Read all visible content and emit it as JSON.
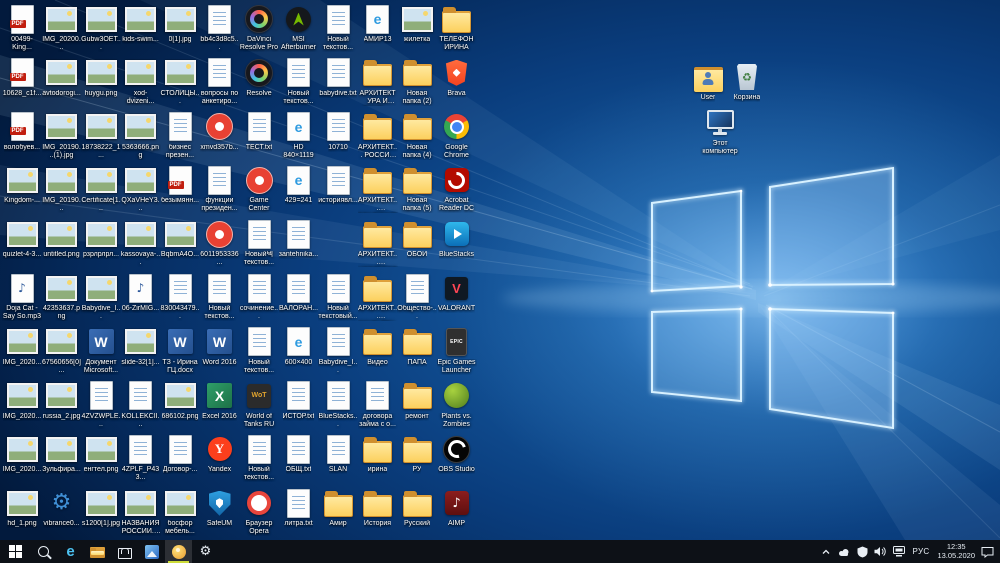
{
  "desktop": {
    "icons": [
      {
        "col": 1,
        "row": 1,
        "label": "00499-King...",
        "type": "pdf"
      },
      {
        "col": 2,
        "row": 1,
        "label": "IMG_20200...",
        "type": "image"
      },
      {
        "col": 3,
        "row": 1,
        "label": "Gubw3OET...",
        "type": "image"
      },
      {
        "col": 4,
        "row": 1,
        "label": "kids-swim...",
        "type": "image"
      },
      {
        "col": 5,
        "row": 1,
        "label": "0[1].jpg",
        "type": "image"
      },
      {
        "col": 6,
        "row": 1,
        "label": "bb4c3d8c5...",
        "type": "text"
      },
      {
        "col": 7,
        "row": 1,
        "label": "DaVinci Resolve Pro",
        "type": "davinci"
      },
      {
        "col": 8,
        "row": 1,
        "label": "MSI Afterburner",
        "type": "msi"
      },
      {
        "col": 9,
        "row": 1,
        "label": "Новый текстов...",
        "type": "text"
      },
      {
        "col": 10,
        "row": 1,
        "label": "АМИР13",
        "type": "html"
      },
      {
        "col": 11,
        "row": 1,
        "label": "жилетка",
        "type": "image"
      },
      {
        "col": 12,
        "row": 1,
        "label": "ТЕЛЕФОН ИРИНА",
        "type": "folder"
      },
      {
        "col": 1,
        "row": 2,
        "label": "10628_c1f...",
        "type": "pdf"
      },
      {
        "col": 2,
        "row": 2,
        "label": "avtodorogi...",
        "type": "image"
      },
      {
        "col": 3,
        "row": 2,
        "label": "huygu.png",
        "type": "image"
      },
      {
        "col": 4,
        "row": 2,
        "label": "xod-dvizeni...",
        "type": "image"
      },
      {
        "col": 5,
        "row": 2,
        "label": "СТОЛИЦЫ...",
        "type": "image"
      },
      {
        "col": 6,
        "row": 2,
        "label": "вопросы по анкетиро...",
        "type": "text"
      },
      {
        "col": 7,
        "row": 2,
        "label": "Resolve",
        "type": "davinci"
      },
      {
        "col": 8,
        "row": 2,
        "label": "Новый текстов...",
        "type": "text"
      },
      {
        "col": 9,
        "row": 2,
        "label": "babydive.txt",
        "type": "text"
      },
      {
        "col": 10,
        "row": 2,
        "label": "АРХИТЕКТУРА И СКУЛЬ...",
        "type": "folder"
      },
      {
        "col": 11,
        "row": 2,
        "label": "Новая папка (2)",
        "type": "folder"
      },
      {
        "col": 12,
        "row": 2,
        "label": "Brava",
        "type": "brave"
      },
      {
        "col": 1,
        "row": 3,
        "label": "волобуев...",
        "type": "pdf"
      },
      {
        "col": 2,
        "row": 3,
        "label": "IMG_20190...(1).jpg",
        "type": "image"
      },
      {
        "col": 3,
        "row": 3,
        "label": "18738222_1...",
        "type": "image"
      },
      {
        "col": 4,
        "row": 3,
        "label": "5363666.png",
        "type": "image"
      },
      {
        "col": 5,
        "row": 3,
        "label": "бизнес презен...",
        "type": "text"
      },
      {
        "col": 6,
        "row": 3,
        "label": "xmvd357b...",
        "type": "gamecenter"
      },
      {
        "col": 7,
        "row": 3,
        "label": "ТЕСТ.txt",
        "type": "text"
      },
      {
        "col": 8,
        "row": 3,
        "label": "HD 840×1119",
        "type": "html"
      },
      {
        "col": 9,
        "row": 3,
        "label": "10710",
        "type": "text"
      },
      {
        "col": 10,
        "row": 3,
        "label": "АРХИТЕКТ... РОССИЯ И...",
        "type": "folder"
      },
      {
        "col": 11,
        "row": 3,
        "label": "Новая папка (4)",
        "type": "folder"
      },
      {
        "col": 12,
        "row": 3,
        "label": "Google Chrome",
        "type": "chrome"
      },
      {
        "col": 1,
        "row": 4,
        "label": "Kingdom-...",
        "type": "image"
      },
      {
        "col": 2,
        "row": 4,
        "label": "IMG_20190...",
        "type": "image"
      },
      {
        "col": 3,
        "row": 4,
        "label": "Certificate[1...",
        "type": "image"
      },
      {
        "col": 4,
        "row": 4,
        "label": "QXaVHeY3...",
        "type": "image"
      },
      {
        "col": 5,
        "row": 4,
        "label": "безымянн...",
        "type": "pdf"
      },
      {
        "col": 6,
        "row": 4,
        "label": "функции президен...",
        "type": "text"
      },
      {
        "col": 7,
        "row": 4,
        "label": "Game Center",
        "type": "gamecenter"
      },
      {
        "col": 8,
        "row": 4,
        "label": "429=241",
        "type": "html"
      },
      {
        "col": 9,
        "row": 4,
        "label": "историявл...",
        "type": "text"
      },
      {
        "col": 10,
        "row": 4,
        "label": "АРХИТЕКТ... ВЛАДИМИР",
        "type": "folder"
      },
      {
        "col": 11,
        "row": 4,
        "label": "Новая папка (5)",
        "type": "folder"
      },
      {
        "col": 12,
        "row": 4,
        "label": "Acrobat Reader DC",
        "type": "acrobat"
      },
      {
        "col": 1,
        "row": 5,
        "label": "quizlet-4-3...",
        "type": "image"
      },
      {
        "col": 2,
        "row": 5,
        "label": "untitled.png",
        "type": "image"
      },
      {
        "col": 3,
        "row": 5,
        "label": "рзрлрлрл...",
        "type": "image"
      },
      {
        "col": 4,
        "row": 5,
        "label": "kassovaya-...",
        "type": "image"
      },
      {
        "col": 5,
        "row": 5,
        "label": "BqbmA4O...",
        "type": "image"
      },
      {
        "col": 6,
        "row": 5,
        "label": "6011953336...",
        "type": "gamecenter"
      },
      {
        "col": 7,
        "row": 5,
        "label": "Новый텍 текстов...",
        "type": "text"
      },
      {
        "col": 8,
        "row": 5,
        "label": "зantehnika...",
        "type": "text"
      },
      {
        "col": 10,
        "row": 5,
        "label": "АРХИТЕКТ... НОВГОРОД",
        "type": "folder"
      },
      {
        "col": 11,
        "row": 5,
        "label": "ОБОИ",
        "type": "folder"
      },
      {
        "col": 12,
        "row": 5,
        "label": "BlueStacks",
        "type": "bluestacks"
      },
      {
        "col": 1,
        "row": 6,
        "label": "Doja Cat - Say So.mp3",
        "type": "mp3"
      },
      {
        "col": 2,
        "row": 6,
        "label": "42353637.png",
        "type": "image"
      },
      {
        "col": 3,
        "row": 6,
        "label": "Babydive_I...",
        "type": "image"
      },
      {
        "col": 4,
        "row": 6,
        "label": "06-ZirMIG...",
        "type": "mp3"
      },
      {
        "col": 5,
        "row": 6,
        "label": "830043479...",
        "type": "text"
      },
      {
        "col": 6,
        "row": 6,
        "label": "Новый текстов...",
        "type": "text"
      },
      {
        "col": 7,
        "row": 6,
        "label": "сочинение...",
        "type": "text"
      },
      {
        "col": 8,
        "row": 6,
        "label": "ВАЛОРАН...",
        "type": "text"
      },
      {
        "col": 9,
        "row": 6,
        "label": "Новый текстовый...",
        "type": "text"
      },
      {
        "col": 10,
        "row": 6,
        "label": "АРХИТЕКТ... СКУЛЬПТУ...",
        "type": "folder"
      },
      {
        "col": 11,
        "row": 6,
        "label": "Общество-...",
        "type": "text"
      },
      {
        "col": 12,
        "row": 6,
        "label": "VALORANT",
        "type": "valorant"
      },
      {
        "col": 1,
        "row": 7,
        "label": "IMG_2020...",
        "type": "image"
      },
      {
        "col": 2,
        "row": 7,
        "label": "67560656[0]...",
        "type": "image"
      },
      {
        "col": 3,
        "row": 7,
        "label": "Документ Microsoft...",
        "type": "word"
      },
      {
        "col": 4,
        "row": 7,
        "label": "slide-32[1]...",
        "type": "image"
      },
      {
        "col": 5,
        "row": 7,
        "label": "ТЗ - Ирина ГЦ.docx",
        "type": "word"
      },
      {
        "col": 6,
        "row": 7,
        "label": "Word 2016",
        "type": "word"
      },
      {
        "col": 7,
        "row": 7,
        "label": "Новый текстов...",
        "type": "text"
      },
      {
        "col": 8,
        "row": 7,
        "label": "600×400",
        "type": "html"
      },
      {
        "col": 9,
        "row": 7,
        "label": "Babydive_I...",
        "type": "text"
      },
      {
        "col": 10,
        "row": 7,
        "label": "Видео",
        "type": "folder"
      },
      {
        "col": 11,
        "row": 7,
        "label": "ПАПА",
        "type": "folder"
      },
      {
        "col": 12,
        "row": 7,
        "label": "Epic Games Launcher",
        "type": "epic"
      },
      {
        "col": 1,
        "row": 8,
        "label": "IMG_2020...",
        "type": "image"
      },
      {
        "col": 2,
        "row": 8,
        "label": "russia_2.jpg",
        "type": "image"
      },
      {
        "col": 3,
        "row": 8,
        "label": "4ZVZWPLE...",
        "type": "text"
      },
      {
        "col": 4,
        "row": 8,
        "label": "KOLLEKCII...",
        "type": "text"
      },
      {
        "col": 5,
        "row": 8,
        "label": "686102.png",
        "type": "image"
      },
      {
        "col": 6,
        "row": 8,
        "label": "Excel 2016",
        "type": "excel"
      },
      {
        "col": 7,
        "row": 8,
        "label": "World of Tanks RU",
        "type": "wot"
      },
      {
        "col": 8,
        "row": 8,
        "label": "ИСТОР.txt",
        "type": "text"
      },
      {
        "col": 9,
        "row": 8,
        "label": "BlueStacks...",
        "type": "text"
      },
      {
        "col": 10,
        "row": 8,
        "label": "договора займа с о...",
        "type": "text"
      },
      {
        "col": 11,
        "row": 8,
        "label": "ремонт",
        "type": "folder"
      },
      {
        "col": 12,
        "row": 8,
        "label": "Plants vs. Zombies",
        "type": "pvz"
      },
      {
        "col": 1,
        "row": 9,
        "label": "IMG_2020...",
        "type": "image"
      },
      {
        "col": 2,
        "row": 9,
        "label": "Зульфира...",
        "type": "image"
      },
      {
        "col": 3,
        "row": 9,
        "label": "енгтел.png",
        "type": "image"
      },
      {
        "col": 4,
        "row": 9,
        "label": "4ZPLF_P433...",
        "type": "text"
      },
      {
        "col": 5,
        "row": 9,
        "label": "Договор-...",
        "type": "text"
      },
      {
        "col": 6,
        "row": 9,
        "label": "Yandex",
        "type": "yandex"
      },
      {
        "col": 7,
        "row": 9,
        "label": "Новый текстов...",
        "type": "text"
      },
      {
        "col": 8,
        "row": 9,
        "label": "ОБЩ.txt",
        "type": "text"
      },
      {
        "col": 9,
        "row": 9,
        "label": "SLAN",
        "type": "text"
      },
      {
        "col": 10,
        "row": 9,
        "label": "ирина",
        "type": "folder"
      },
      {
        "col": 11,
        "row": 9,
        "label": "РУ",
        "type": "folder"
      },
      {
        "col": 12,
        "row": 9,
        "label": "OBS Studio",
        "type": "obs"
      },
      {
        "col": 1,
        "row": 10,
        "label": "hd_1.png",
        "type": "image"
      },
      {
        "col": 2,
        "row": 10,
        "label": "vibrance0...",
        "type": "gear"
      },
      {
        "col": 3,
        "row": 10,
        "label": "s1200[1].jpg",
        "type": "image"
      },
      {
        "col": 4,
        "row": 10,
        "label": "НАЗВАНИЯ РОССИИ.jpg",
        "type": "image"
      },
      {
        "col": 5,
        "row": 10,
        "label": "босфор мебель...",
        "type": "image"
      },
      {
        "col": 6,
        "row": 10,
        "label": "SafeUM",
        "type": "safeum"
      },
      {
        "col": 7,
        "row": 10,
        "label": "Браузер Opera",
        "type": "opera"
      },
      {
        "col": 8,
        "row": 10,
        "label": "литра.txt",
        "type": "text"
      },
      {
        "col": 9,
        "row": 10,
        "label": "Амир",
        "type": "folder"
      },
      {
        "col": 10,
        "row": 10,
        "label": "История",
        "type": "folder"
      },
      {
        "col": 11,
        "row": 10,
        "label": "Русский",
        "type": "folder"
      },
      {
        "col": 12,
        "row": 10,
        "label": "AIMP",
        "type": "aimp"
      }
    ],
    "right_icons": [
      {
        "label": "User",
        "type": "user"
      },
      {
        "label": "Корзина",
        "type": "recycle"
      },
      {
        "label": "Этот компьютер",
        "type": "thispc"
      }
    ]
  },
  "taskbar": {
    "language": "РУС",
    "time": "12:35",
    "date": "13.05.2020",
    "pinned_apps": [
      {
        "name": "search"
      },
      {
        "name": "edge"
      },
      {
        "name": "file-explorer"
      },
      {
        "name": "store"
      },
      {
        "name": "photos"
      },
      {
        "name": "paint",
        "active": true
      },
      {
        "name": "settings"
      }
    ],
    "tray_icons": [
      "hidden-icons",
      "onedrive",
      "defender",
      "volume",
      "network"
    ]
  }
}
